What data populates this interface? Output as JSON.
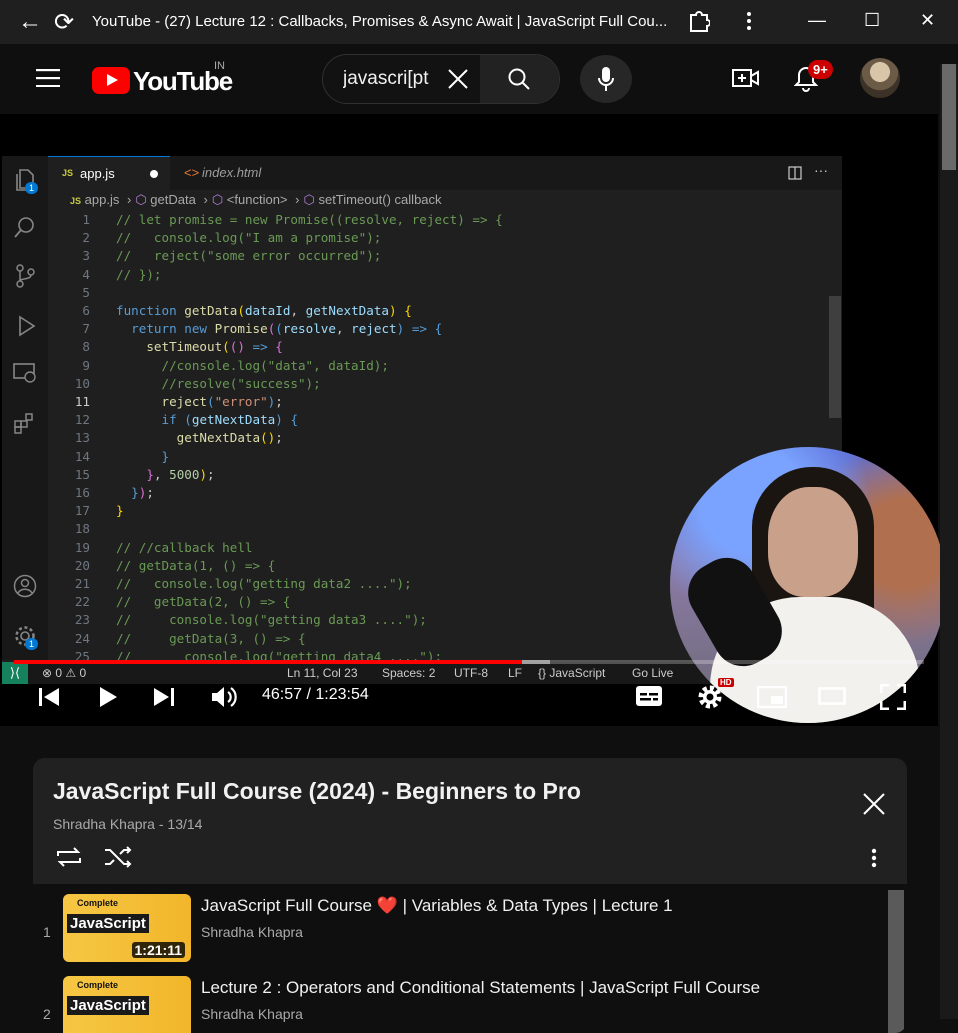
{
  "browser": {
    "title": "YouTube - (27) Lecture 12 : Callbacks, Promises & Async Await | JavaScript Full Cou...",
    "back": "←",
    "reload": "⟳",
    "minimize": "—",
    "maximize": "☐",
    "close": "✕"
  },
  "youtube": {
    "logo_text": "YouTube",
    "country": "IN",
    "search_value": "javascri[pt",
    "notification_count": "9+"
  },
  "vscode": {
    "tabs": [
      {
        "label": "app.js",
        "icon": "JS",
        "modified": true
      },
      {
        "label": "index.html",
        "icon": "<>"
      }
    ],
    "breadcrumb": [
      "app.js",
      "getData",
      "<function>",
      "setTimeout() callback"
    ],
    "explorer_badge": "1",
    "settings_badge": "1",
    "status": {
      "problems": "⊗ 0 ⚠ 0",
      "position": "Ln 11, Col 23",
      "spaces": "Spaces: 2",
      "encoding": "UTF-8",
      "eol": "LF",
      "language": "{} JavaScript",
      "golive": "Go Live"
    },
    "line_numbers": [
      "1",
      "2",
      "3",
      "4",
      "5",
      "6",
      "7",
      "8",
      "9",
      "10",
      "11",
      "12",
      "13",
      "14",
      "15",
      "16",
      "17",
      "18",
      "19",
      "20",
      "21",
      "22",
      "23",
      "24",
      "25"
    ]
  },
  "player": {
    "time": "46:57 / 1:23:54",
    "hd_badge": "HD",
    "progress": 0.558,
    "buffered": 0.589
  },
  "playlist": {
    "title": "JavaScript Full Course (2024) - Beginners to Pro",
    "subtitle": "Shradha Khapra - 13/14",
    "items": [
      {
        "index": "1",
        "title": "JavaScript Full Course ❤️ | Variables & Data Types | Lecture 1",
        "author": "Shradha Khapra",
        "duration": "1:21:11",
        "thumb_top": "Complete",
        "thumb_label": "JavaScript"
      },
      {
        "index": "2",
        "title": "Lecture 2 : Operators and Conditional Statements | JavaScript Full Course",
        "author": "Shradha Khapra",
        "duration": "",
        "thumb_top": "Complete",
        "thumb_label": "JavaScript"
      }
    ]
  },
  "colors": {
    "youtube_red": "#ff0000",
    "vscode_status_remote": "#16825d",
    "badge_red": "#cc0000"
  }
}
